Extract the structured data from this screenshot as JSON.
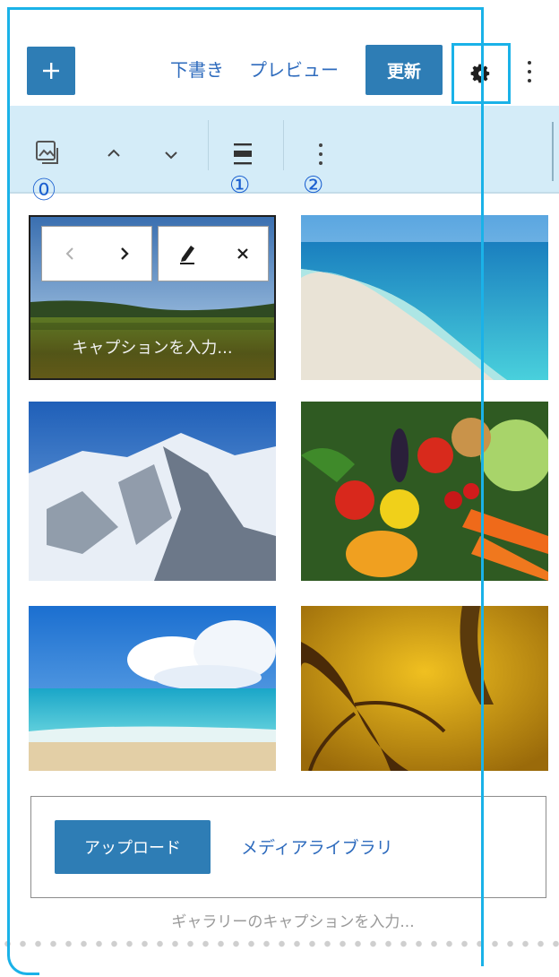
{
  "header": {
    "draft_label": "下書き",
    "preview_label": "プレビュー",
    "update_label": "更新"
  },
  "block_toolbar": {
    "numbers": [
      "⓪",
      "①",
      "②"
    ]
  },
  "gallery": {
    "first_caption_placeholder": "キャプションを入力...",
    "images": [
      "grassland-field",
      "tropical-beach",
      "snowy-mountain",
      "vegetables",
      "ocean-sky",
      "autumn-forest"
    ]
  },
  "upload": {
    "upload_label": "アップロード",
    "media_library_label": "メディアライブラリ",
    "gallery_caption_placeholder": "ギャラリーのキャプションを入力..."
  },
  "colors": {
    "accent": "#2e7db5",
    "callout": "#1ab2e8",
    "toolbar_bg": "#d4ecf8",
    "number_color": "#1a5fd0"
  }
}
